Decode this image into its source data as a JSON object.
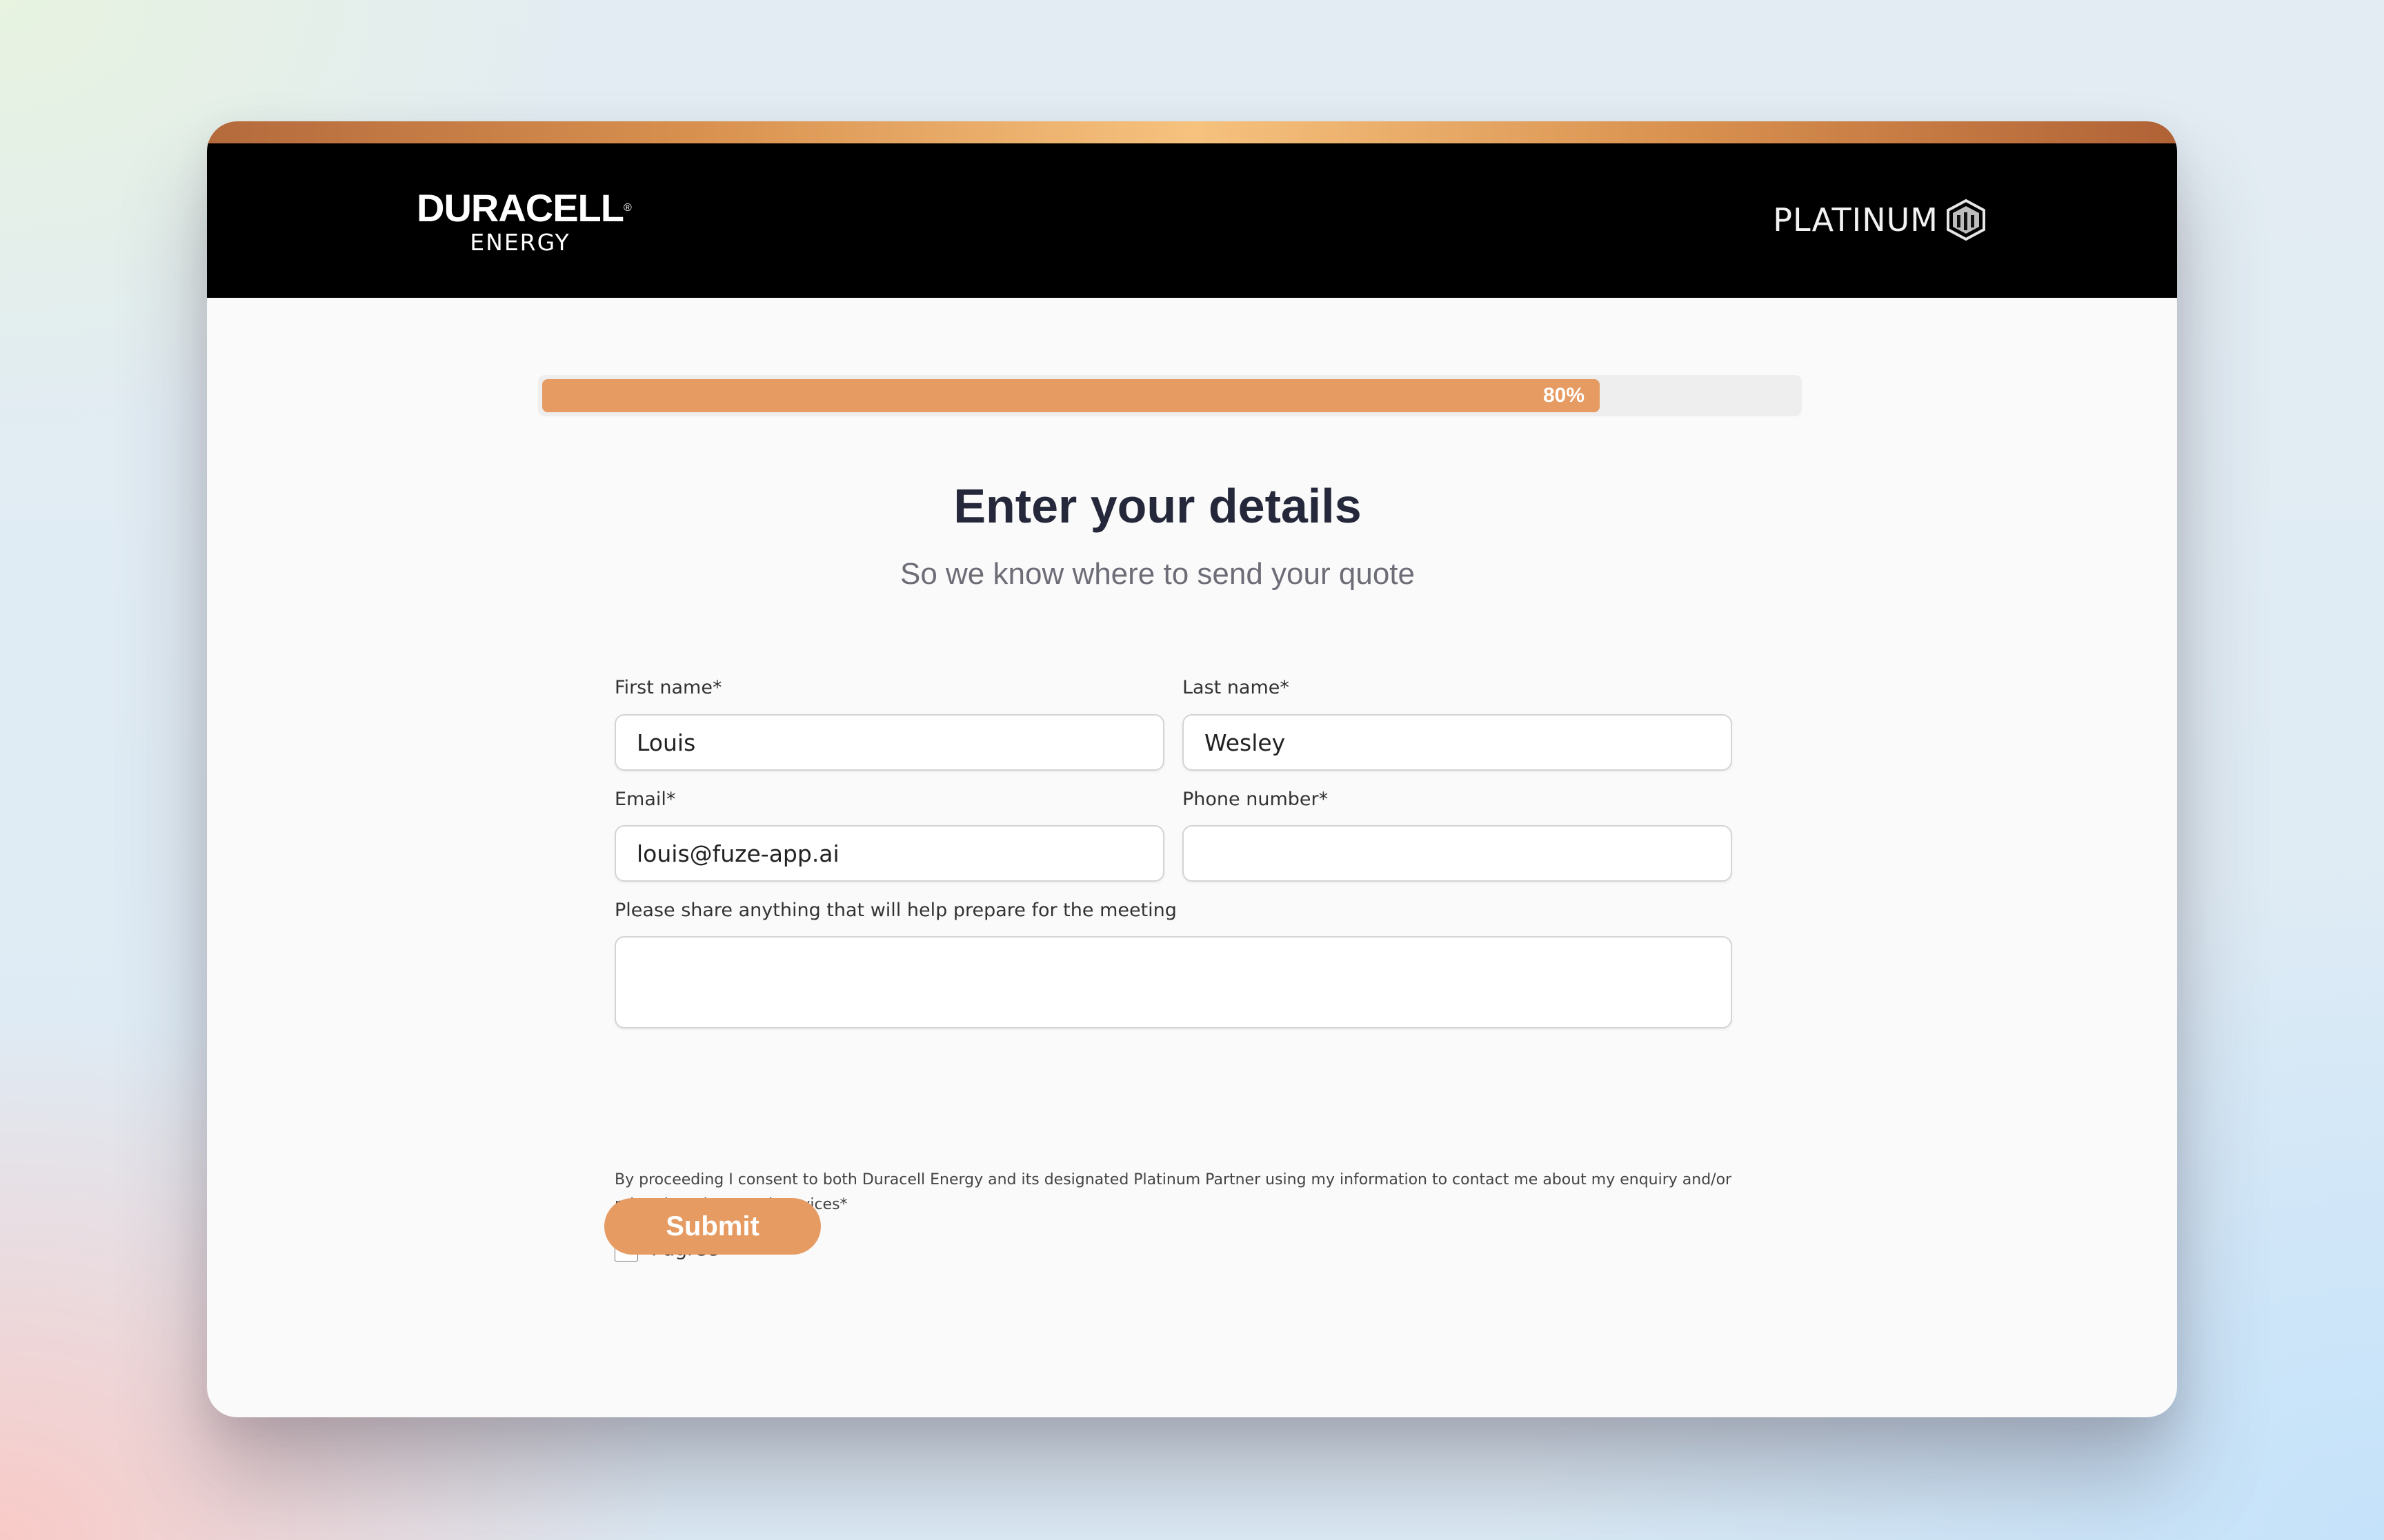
{
  "header": {
    "brand_name": "DURACELL",
    "brand_reg": "®",
    "brand_sub": "ENERGY",
    "partner_label": "PLATINUM",
    "partner_icon": "platinum-cube-icon"
  },
  "progress": {
    "percent": 80,
    "label": "80%"
  },
  "form": {
    "title": "Enter your details",
    "subtitle": "So we know where to send your quote",
    "first_name": {
      "label": "First name*",
      "value": "Louis"
    },
    "last_name": {
      "label": "Last name*",
      "value": "Wesley"
    },
    "email": {
      "label": "Email*",
      "value": "louis@fuze-app.ai"
    },
    "phone": {
      "label": "Phone number*",
      "value": ""
    },
    "notes": {
      "label": "Please share anything that will help prepare for the meeting",
      "value": ""
    },
    "consent_text": "By proceeding I consent to both Duracell Energy and its designated Platinum Partner using my information to contact me about my enquiry and/or related products and services*",
    "agree_label": "I agree",
    "agree_checked": false,
    "submit_label": "Submit"
  },
  "colors": {
    "accent": "#e69b62",
    "header_bg": "#000000",
    "title": "#25283a"
  }
}
